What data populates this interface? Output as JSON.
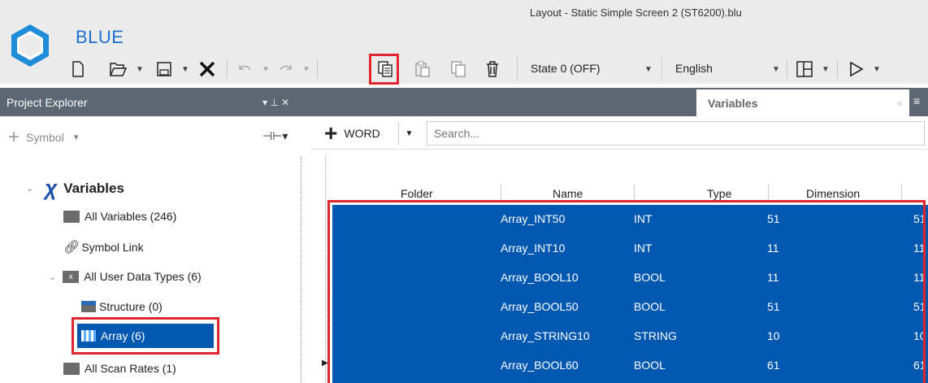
{
  "app": {
    "name": "BLUE",
    "window_title": "Layout - Static Simple Screen 2 (ST6200).blu"
  },
  "toolbar": {
    "state": "State 0 (OFF)",
    "language": "English"
  },
  "project_explorer": {
    "title": "Project Explorer",
    "pin_glyph": "▾ ⊥ ✕",
    "add_label": "Symbol",
    "tree": {
      "root": "Variables",
      "items": [
        {
          "label": "All Variables (246)",
          "icon": "folder-icon"
        },
        {
          "label": "Symbol Link",
          "icon": "link-icon"
        },
        {
          "label": "All User Data Types (6)",
          "icon": "udt-icon"
        },
        {
          "label": "Structure (0)",
          "icon": "structure-icon"
        },
        {
          "label": "Array (6)",
          "icon": "array-icon"
        },
        {
          "label": "All Scan Rates (1)",
          "icon": "folder-icon"
        }
      ]
    }
  },
  "tabs": {
    "active": "Variables"
  },
  "variables": {
    "type_filter": "WORD",
    "search_placeholder": "Search...",
    "columns": [
      "Folder",
      "Name",
      "Type",
      "Dimension"
    ],
    "rows": [
      {
        "name": "Array_INT50",
        "type": "INT",
        "size": "51",
        "dimension": "51"
      },
      {
        "name": "Array_INT10",
        "type": "INT",
        "size": "11",
        "dimension": "11"
      },
      {
        "name": "Array_BOOL10",
        "type": "BOOL",
        "size": "11",
        "dimension": "11"
      },
      {
        "name": "Array_BOOL50",
        "type": "BOOL",
        "size": "51",
        "dimension": "51"
      },
      {
        "name": "Array_STRING10",
        "type": "STRING",
        "size": "10",
        "dimension": "10"
      },
      {
        "name": "Array_BOOL60",
        "type": "BOOL",
        "size": "61",
        "dimension": "61"
      }
    ]
  },
  "colors": {
    "selection": "#0058b0",
    "header": "#5c6773",
    "highlight": "#e0252e",
    "brand": "#1e6fd0"
  }
}
